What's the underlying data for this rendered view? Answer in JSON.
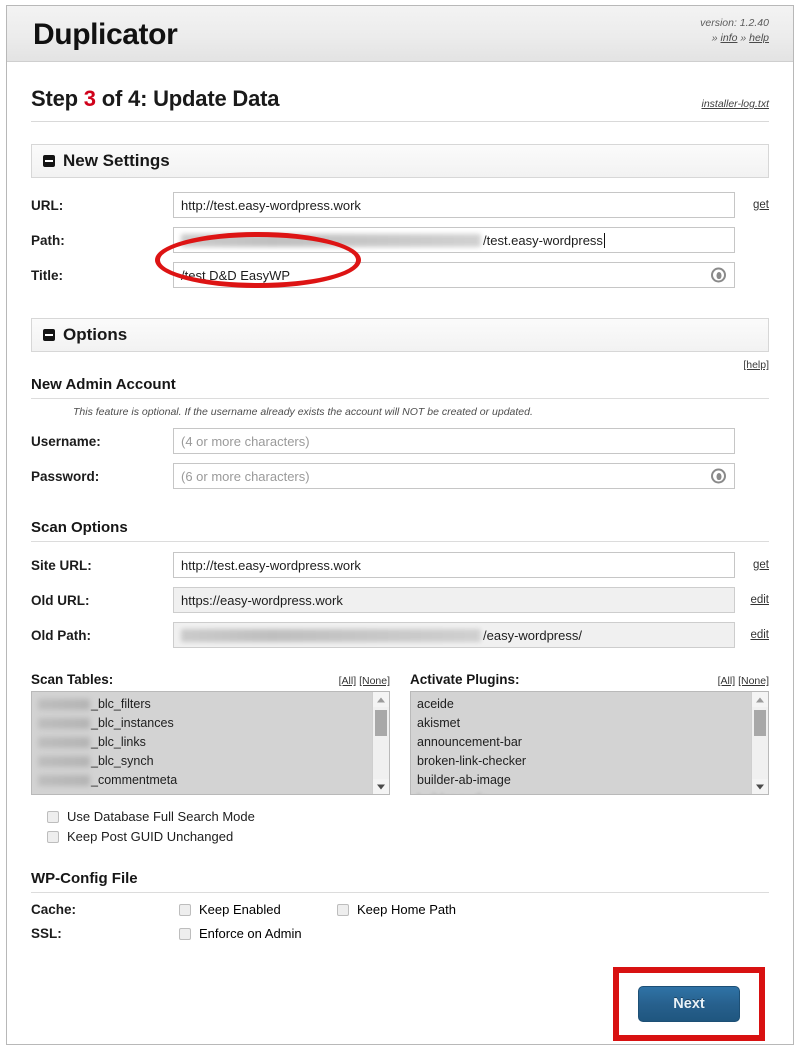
{
  "header": {
    "app_title": "Duplicator",
    "version": "version: 1.2.40",
    "info_prefix": "»",
    "info_label": "info",
    "help_prefix": "»",
    "help_label": "help"
  },
  "step": {
    "prefix": "Step",
    "number": "3",
    "suffix": "of 4: Update Data",
    "log_link": "installer-log.txt"
  },
  "new_settings": {
    "section_title": "New Settings",
    "url_label": "URL:",
    "url_value": "http://test.easy-wordpress.work",
    "url_action": "get",
    "path_label": "Path:",
    "path_value": "/test.easy-wordpress",
    "path_redacted": true,
    "title_label": "Title:",
    "title_value": "/test D&D EasyWP"
  },
  "options": {
    "section_title": "Options",
    "help_label": "[help]",
    "admin_heading": "New Admin Account",
    "admin_note": "This feature is optional. If the username already exists the account will NOT be created or updated.",
    "username_label": "Username:",
    "username_placeholder": "(4 or more characters)",
    "password_label": "Password:",
    "password_placeholder": "(6 or more characters)"
  },
  "scan_options": {
    "heading": "Scan Options",
    "site_url_label": "Site URL:",
    "site_url_value": "http://test.easy-wordpress.work",
    "site_url_action": "get",
    "old_url_label": "Old URL:",
    "old_url_value": "https://easy-wordpress.work",
    "old_url_action": "edit",
    "old_path_label": "Old Path:",
    "old_path_value": "/easy-wordpress/",
    "old_path_action": "edit"
  },
  "scan_tables": {
    "title": "Scan Tables:",
    "all_label": "[All]",
    "none_label": "[None]",
    "items": [
      "_blc_filters",
      "_blc_instances",
      "_blc_links",
      "_blc_synch",
      "_commentmeta"
    ]
  },
  "activate_plugins": {
    "title": "Activate Plugins:",
    "all_label": "[All]",
    "none_label": "[None]",
    "items": [
      "aceide",
      "akismet",
      "announcement-bar",
      "broken-link-checker",
      "builder-ab-image"
    ]
  },
  "scan_checkboxes": [
    {
      "label": "Use Database Full Search Mode",
      "checked": false
    },
    {
      "label": "Keep Post GUID Unchanged",
      "checked": false
    }
  ],
  "wp_config": {
    "heading": "WP-Config File",
    "cache_label": "Cache:",
    "cache_opt1": "Keep Enabled",
    "cache_opt2": "Keep Home Path",
    "ssl_label": "SSL:",
    "ssl_opt1": "Enforce on Admin"
  },
  "footer": {
    "next_label": "Next"
  },
  "annotations": {
    "ellipse_color": "#dd1414",
    "box_color": "#d81111"
  },
  "colors": {
    "accent_red": "#d0021b",
    "button_blue": "#27608d",
    "header_bg": "#ececec"
  }
}
